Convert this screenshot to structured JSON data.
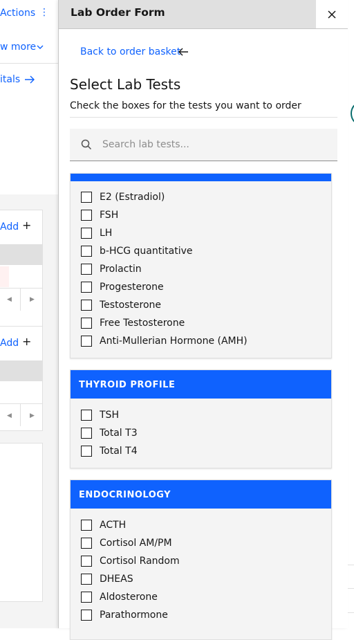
{
  "background_page": {
    "actions_label": "Actions",
    "actions_menu_icon": "⋮",
    "show_more_label": "w more",
    "vitals_link_label": "itals",
    "cards": [
      {
        "add_label": "Add",
        "plus": "+"
      },
      {
        "add_label": "Add",
        "plus": "+"
      }
    ]
  },
  "panel": {
    "title": "Lab Order Form",
    "close_icon": "close-icon",
    "back_link": "Back to order basket",
    "heading": "Select Lab Tests",
    "subheading": "Check the boxes for the tests you want to order",
    "search": {
      "placeholder": "Search lab tests...",
      "value": ""
    },
    "groups": [
      {
        "title": "",
        "tests": [
          "E2 (Estradiol)",
          "FSH",
          "LH",
          "b-HCG quantitative",
          "Prolactin",
          "Progesterone",
          "Testosterone",
          "Free Testosterone",
          "Anti-Mullerian Hormone (AMH)"
        ]
      },
      {
        "title": "THYROID PROFILE",
        "tests": [
          "TSH",
          "Total T3",
          "Total T4"
        ]
      },
      {
        "title": "ENDOCRINOLOGY",
        "tests": [
          "ACTH",
          "Cortisol AM/PM",
          "Cortisol Random",
          "DHEAS",
          "Aldosterone",
          "Parathormone"
        ]
      }
    ]
  },
  "colors": {
    "accent": "#0f62fe",
    "header_bg": "#e0e0e0",
    "group_bg": "#f4f4f4"
  }
}
